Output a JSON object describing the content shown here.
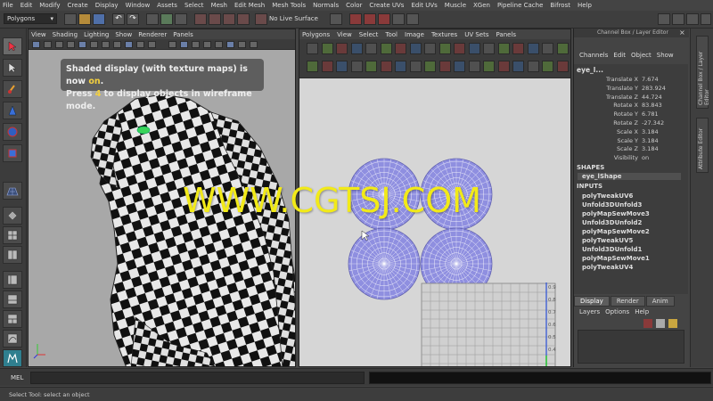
{
  "menubar": [
    "File",
    "Edit",
    "Modify",
    "Create",
    "Display",
    "Window",
    "Assets",
    "Select",
    "Mesh",
    "Edit Mesh",
    "Mesh Tools",
    "Normals",
    "Color",
    "Create UVs",
    "Edit UVs",
    "Muscle",
    "XGen",
    "Pipeline Cache",
    "Bifrost",
    "Help"
  ],
  "status": {
    "mode": "Polygons",
    "live_surface": "No Live Surface"
  },
  "viewport": {
    "menu": [
      "View",
      "Shading",
      "Lighting",
      "Show",
      "Renderer",
      "Panels"
    ],
    "hud_line1_pre": "Shaded display (with texture maps) is now ",
    "hud_line1_key": "on",
    "hud_line1_post": ".",
    "hud_line2_pre": "Press ",
    "hud_line2_key": "4",
    "hud_line2_post": " to display objects in wireframe mode."
  },
  "uv_editor": {
    "menu": [
      "Polygons",
      "View",
      "Select",
      "Tool",
      "Image",
      "Textures",
      "UV Sets",
      "Panels"
    ],
    "grid_labels": [
      "0.9",
      "0.8",
      "0.7",
      "0.6",
      "0.5",
      "0.4"
    ]
  },
  "channel_box": {
    "title": "Channel Box / Layer Editor",
    "menu": [
      "Channels",
      "Edit",
      "Object",
      "Show"
    ],
    "object": "eye_l...",
    "attributes": [
      {
        "name": "Translate X",
        "value": "7.674"
      },
      {
        "name": "Translate Y",
        "value": "283.924"
      },
      {
        "name": "Translate Z",
        "value": "44.724"
      },
      {
        "name": "Rotate X",
        "value": "83.843"
      },
      {
        "name": "Rotate Y",
        "value": "6.781"
      },
      {
        "name": "Rotate Z",
        "value": "-27.342"
      },
      {
        "name": "Scale X",
        "value": "3.184"
      },
      {
        "name": "Scale Y",
        "value": "3.184"
      },
      {
        "name": "Scale Z",
        "value": "3.184"
      },
      {
        "name": "Visibility",
        "value": "on"
      }
    ],
    "shapes_header": "SHAPES",
    "shape_name": "eye_lShape",
    "inputs_header": "INPUTS",
    "inputs": [
      "polyTweakUV6",
      "Unfold3DUnfold3",
      "polyMapSewMove3",
      "Unfold3DUnfold2",
      "polyMapSewMove2",
      "polyTweakUV5",
      "Unfold3DUnfold1",
      "polyMapSewMove1",
      "polyTweakUV4"
    ]
  },
  "layer_editor": {
    "tabs": [
      "Display",
      "Render",
      "Anim"
    ],
    "menu": [
      "Layers",
      "Options",
      "Help"
    ]
  },
  "side_tabs": [
    "Channel Box / Layer Editor",
    "Attribute Editor"
  ],
  "mel_label": "MEL",
  "help_text": "Select Tool: select an object",
  "watermark": "WWW.CGTSJ.COM",
  "colors": {
    "accent": "#f4d03f",
    "uv_shell": "#8f8fe0",
    "watermark": "#f2ea18"
  }
}
